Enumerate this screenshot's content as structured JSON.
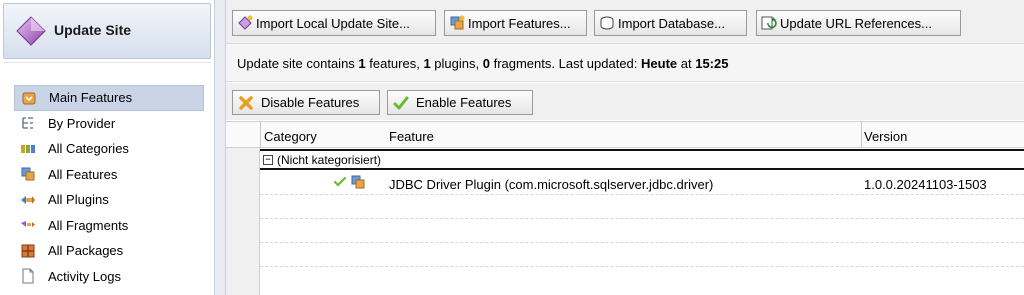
{
  "left_panel": {
    "title": "Update Site",
    "nav": [
      {
        "label": "Main Features",
        "icon": "main-features-icon",
        "selected": true
      },
      {
        "label": "By Provider",
        "icon": "provider-icon",
        "selected": false
      },
      {
        "label": "All Categories",
        "icon": "categories-icon",
        "selected": false
      },
      {
        "label": "All Features",
        "icon": "features-icon",
        "selected": false
      },
      {
        "label": "All Plugins",
        "icon": "plugins-icon",
        "selected": false
      },
      {
        "label": "All Fragments",
        "icon": "fragments-icon",
        "selected": false
      },
      {
        "label": "All Packages",
        "icon": "packages-icon",
        "selected": false
      },
      {
        "label": "Activity Logs",
        "icon": "document-icon",
        "selected": false
      }
    ]
  },
  "toolbar": {
    "import_local": "Import Local Update Site...",
    "import_features": "Import Features...",
    "import_database": "Import Database...",
    "update_url": "Update URL References..."
  },
  "info": {
    "prefix": "Update site contains ",
    "features_count": "1",
    "features_label": " features, ",
    "plugins_count": "1",
    "plugins_label": " plugins, ",
    "fragments_count": "0",
    "fragments_label": " fragments. Last updated: ",
    "day": "Heute",
    "at": " at ",
    "time": "15:25"
  },
  "actions": {
    "disable": "Disable Features",
    "enable": "Enable Features"
  },
  "table": {
    "columns": {
      "category": "Category",
      "feature": "Feature",
      "version": "Version"
    },
    "group": {
      "expander": "−",
      "label": "(Nicht kategorisiert)"
    },
    "rows": [
      {
        "feature": "JDBC Driver Plugin (com.microsoft.sqlserver.jdbc.driver)",
        "version": "1.0.0.20241103-1503",
        "enabled": true
      }
    ]
  },
  "colors": {
    "selection": "#c9d4e6",
    "header_gradient_top": "#f2f5fa",
    "header_gradient_bottom": "#d6dfec"
  }
}
